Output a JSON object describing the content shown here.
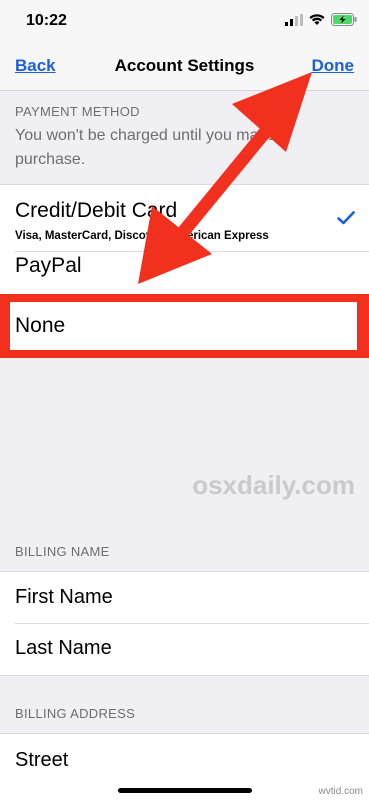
{
  "status": {
    "time": "10:22"
  },
  "nav": {
    "back": "Back",
    "title": "Account Settings",
    "done": "Done"
  },
  "payment": {
    "header": "PAYMENT METHOD",
    "note": "You won't be charged until you make a purchase.",
    "options": [
      {
        "label": "Credit/Debit Card",
        "sub": "Visa, MasterCard, Discover, American Express",
        "selected": true
      },
      {
        "label": "PayPal"
      },
      {
        "label": "None"
      }
    ]
  },
  "watermark": "osxdaily.com",
  "billing_name": {
    "header": "BILLING NAME",
    "fields": [
      "First Name",
      "Last Name"
    ]
  },
  "billing_address": {
    "header": "BILLING ADDRESS",
    "fields": [
      "Street"
    ]
  },
  "credit": "wvtid.com",
  "colors": {
    "accent": "#1a60d6",
    "annotation_red": "#f2301e"
  }
}
